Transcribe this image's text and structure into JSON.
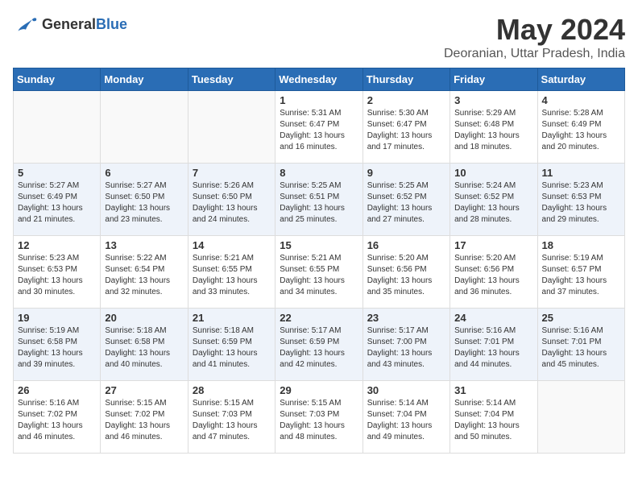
{
  "logo": {
    "text_general": "General",
    "text_blue": "Blue"
  },
  "title": "May 2024",
  "subtitle": "Deoranian, Uttar Pradesh, India",
  "weekdays": [
    "Sunday",
    "Monday",
    "Tuesday",
    "Wednesday",
    "Thursday",
    "Friday",
    "Saturday"
  ],
  "weeks": [
    [
      {
        "day": "",
        "info": ""
      },
      {
        "day": "",
        "info": ""
      },
      {
        "day": "",
        "info": ""
      },
      {
        "day": "1",
        "info": "Sunrise: 5:31 AM\nSunset: 6:47 PM\nDaylight: 13 hours and 16 minutes."
      },
      {
        "day": "2",
        "info": "Sunrise: 5:30 AM\nSunset: 6:47 PM\nDaylight: 13 hours and 17 minutes."
      },
      {
        "day": "3",
        "info": "Sunrise: 5:29 AM\nSunset: 6:48 PM\nDaylight: 13 hours and 18 minutes."
      },
      {
        "day": "4",
        "info": "Sunrise: 5:28 AM\nSunset: 6:49 PM\nDaylight: 13 hours and 20 minutes."
      }
    ],
    [
      {
        "day": "5",
        "info": "Sunrise: 5:27 AM\nSunset: 6:49 PM\nDaylight: 13 hours and 21 minutes."
      },
      {
        "day": "6",
        "info": "Sunrise: 5:27 AM\nSunset: 6:50 PM\nDaylight: 13 hours and 23 minutes."
      },
      {
        "day": "7",
        "info": "Sunrise: 5:26 AM\nSunset: 6:50 PM\nDaylight: 13 hours and 24 minutes."
      },
      {
        "day": "8",
        "info": "Sunrise: 5:25 AM\nSunset: 6:51 PM\nDaylight: 13 hours and 25 minutes."
      },
      {
        "day": "9",
        "info": "Sunrise: 5:25 AM\nSunset: 6:52 PM\nDaylight: 13 hours and 27 minutes."
      },
      {
        "day": "10",
        "info": "Sunrise: 5:24 AM\nSunset: 6:52 PM\nDaylight: 13 hours and 28 minutes."
      },
      {
        "day": "11",
        "info": "Sunrise: 5:23 AM\nSunset: 6:53 PM\nDaylight: 13 hours and 29 minutes."
      }
    ],
    [
      {
        "day": "12",
        "info": "Sunrise: 5:23 AM\nSunset: 6:53 PM\nDaylight: 13 hours and 30 minutes."
      },
      {
        "day": "13",
        "info": "Sunrise: 5:22 AM\nSunset: 6:54 PM\nDaylight: 13 hours and 32 minutes."
      },
      {
        "day": "14",
        "info": "Sunrise: 5:21 AM\nSunset: 6:55 PM\nDaylight: 13 hours and 33 minutes."
      },
      {
        "day": "15",
        "info": "Sunrise: 5:21 AM\nSunset: 6:55 PM\nDaylight: 13 hours and 34 minutes."
      },
      {
        "day": "16",
        "info": "Sunrise: 5:20 AM\nSunset: 6:56 PM\nDaylight: 13 hours and 35 minutes."
      },
      {
        "day": "17",
        "info": "Sunrise: 5:20 AM\nSunset: 6:56 PM\nDaylight: 13 hours and 36 minutes."
      },
      {
        "day": "18",
        "info": "Sunrise: 5:19 AM\nSunset: 6:57 PM\nDaylight: 13 hours and 37 minutes."
      }
    ],
    [
      {
        "day": "19",
        "info": "Sunrise: 5:19 AM\nSunset: 6:58 PM\nDaylight: 13 hours and 39 minutes."
      },
      {
        "day": "20",
        "info": "Sunrise: 5:18 AM\nSunset: 6:58 PM\nDaylight: 13 hours and 40 minutes."
      },
      {
        "day": "21",
        "info": "Sunrise: 5:18 AM\nSunset: 6:59 PM\nDaylight: 13 hours and 41 minutes."
      },
      {
        "day": "22",
        "info": "Sunrise: 5:17 AM\nSunset: 6:59 PM\nDaylight: 13 hours and 42 minutes."
      },
      {
        "day": "23",
        "info": "Sunrise: 5:17 AM\nSunset: 7:00 PM\nDaylight: 13 hours and 43 minutes."
      },
      {
        "day": "24",
        "info": "Sunrise: 5:16 AM\nSunset: 7:01 PM\nDaylight: 13 hours and 44 minutes."
      },
      {
        "day": "25",
        "info": "Sunrise: 5:16 AM\nSunset: 7:01 PM\nDaylight: 13 hours and 45 minutes."
      }
    ],
    [
      {
        "day": "26",
        "info": "Sunrise: 5:16 AM\nSunset: 7:02 PM\nDaylight: 13 hours and 46 minutes."
      },
      {
        "day": "27",
        "info": "Sunrise: 5:15 AM\nSunset: 7:02 PM\nDaylight: 13 hours and 46 minutes."
      },
      {
        "day": "28",
        "info": "Sunrise: 5:15 AM\nSunset: 7:03 PM\nDaylight: 13 hours and 47 minutes."
      },
      {
        "day": "29",
        "info": "Sunrise: 5:15 AM\nSunset: 7:03 PM\nDaylight: 13 hours and 48 minutes."
      },
      {
        "day": "30",
        "info": "Sunrise: 5:14 AM\nSunset: 7:04 PM\nDaylight: 13 hours and 49 minutes."
      },
      {
        "day": "31",
        "info": "Sunrise: 5:14 AM\nSunset: 7:04 PM\nDaylight: 13 hours and 50 minutes."
      },
      {
        "day": "",
        "info": ""
      }
    ]
  ]
}
